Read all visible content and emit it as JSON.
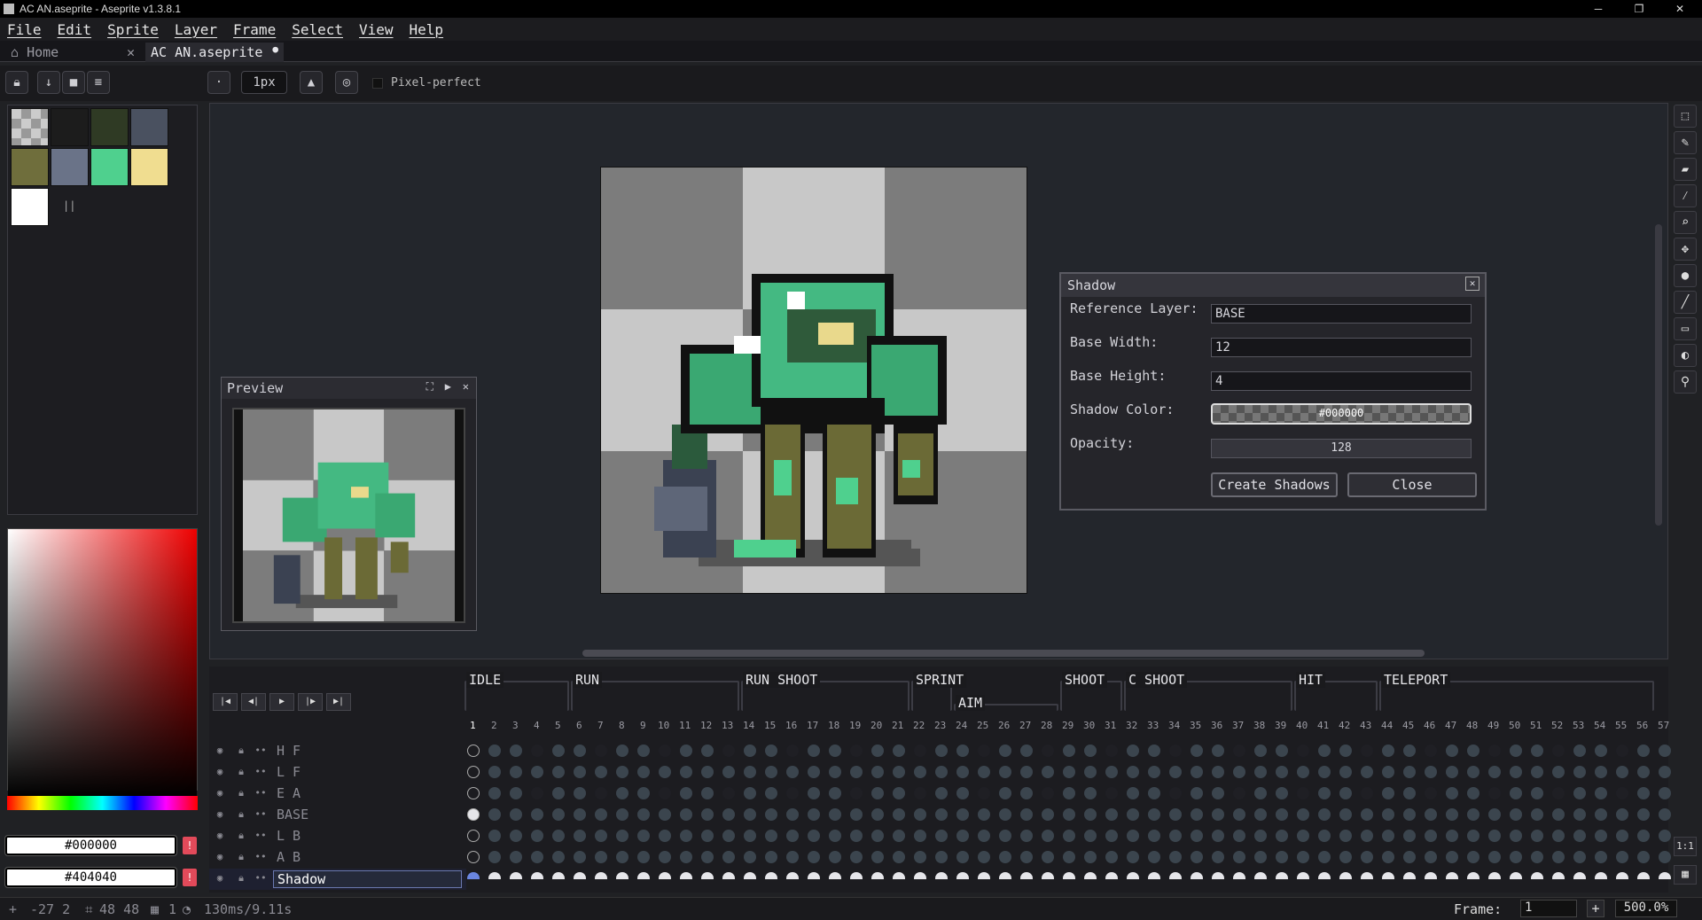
{
  "window": {
    "title": "AC AN.aseprite - Aseprite v1.3.8.1",
    "controls": [
      "─",
      "❐",
      "✕"
    ]
  },
  "menu": [
    "File",
    "Edit",
    "Sprite",
    "Layer",
    "Frame",
    "Select",
    "View",
    "Help"
  ],
  "tabs": [
    {
      "label": "Home",
      "icon": "home-icon",
      "close": "✕"
    },
    {
      "label": "AC AN.aseprite",
      "modified": "●"
    }
  ],
  "toolbar": {
    "brush_size": "1px",
    "pixel_perfect_label": "Pixel-perfect"
  },
  "palette": {
    "swatches": [
      "checker",
      "#1c1c1c",
      "#2f3a24",
      "#4a5160",
      "#6f6e3c",
      "#6a7388",
      "#4fd08e",
      "#f0dd90",
      "#ffffff"
    ],
    "extra_label": "||"
  },
  "colors": {
    "fg": "#000000",
    "bg": "#404040"
  },
  "preview": {
    "title": "Preview"
  },
  "shadow_dialog": {
    "title": "Shadow",
    "reference_layer_label": "Reference Layer:",
    "reference_layer_value": "BASE",
    "base_width_label": "Base Width:",
    "base_width_value": "12",
    "base_height_label": "Base Height:",
    "base_height_value": "4",
    "shadow_color_label": "Shadow Color:",
    "shadow_color_value": "#000000",
    "opacity_label": "Opacity:",
    "opacity_value": "128",
    "create_button": "Create Shadows",
    "close_button": "Close"
  },
  "timeline": {
    "tags": [
      {
        "label": "IDLE",
        "start": 1,
        "end": 5
      },
      {
        "label": "RUN",
        "start": 6,
        "end": 13
      },
      {
        "label": "RUN SHOOT",
        "start": 14,
        "end": 21
      },
      {
        "label": "SPRINT",
        "start": 22,
        "end": 23
      },
      {
        "label": "AIM",
        "start": 24,
        "end": 28
      },
      {
        "label": "SHOOT",
        "start": 29,
        "end": 31
      },
      {
        "label": "C SHOOT",
        "start": 32,
        "end": 39
      },
      {
        "label": "HIT",
        "start": 40,
        "end": 43
      },
      {
        "label": "TELEPORT",
        "start": 44,
        "end": 56
      }
    ],
    "frame_numbers": [
      "1",
      "2",
      "3",
      "4",
      "5",
      "6",
      "7",
      "8",
      "9",
      "10",
      "11",
      "12",
      "13",
      "14",
      "15",
      "16",
      "17",
      "18",
      "19",
      "20",
      "21",
      "22",
      "23",
      "24",
      "25",
      "26",
      "27",
      "28",
      "29",
      "30",
      "31",
      "32",
      "33",
      "34",
      "35",
      "36",
      "37",
      "38",
      "39",
      "40",
      "41",
      "42",
      "43",
      "44",
      "45",
      "46",
      "47",
      "48",
      "49",
      "50",
      "51",
      "52",
      "53",
      "54",
      "55",
      "56",
      "57"
    ],
    "layers": [
      "H F",
      "L F",
      "E A",
      "BASE",
      "L B",
      "A B",
      "Shadow"
    ],
    "selected_layer": "Shadow",
    "playback_buttons": [
      "first-frame-icon",
      "prev-frame-icon",
      "play-icon",
      "next-frame-icon",
      "last-frame-icon"
    ]
  },
  "status": {
    "coords": "-27 2",
    "size": "48 48",
    "frame_count": "1",
    "duration": "130ms/9.11s",
    "frame_label": "Frame:",
    "frame_value": "1",
    "zoom": "500.0%"
  }
}
